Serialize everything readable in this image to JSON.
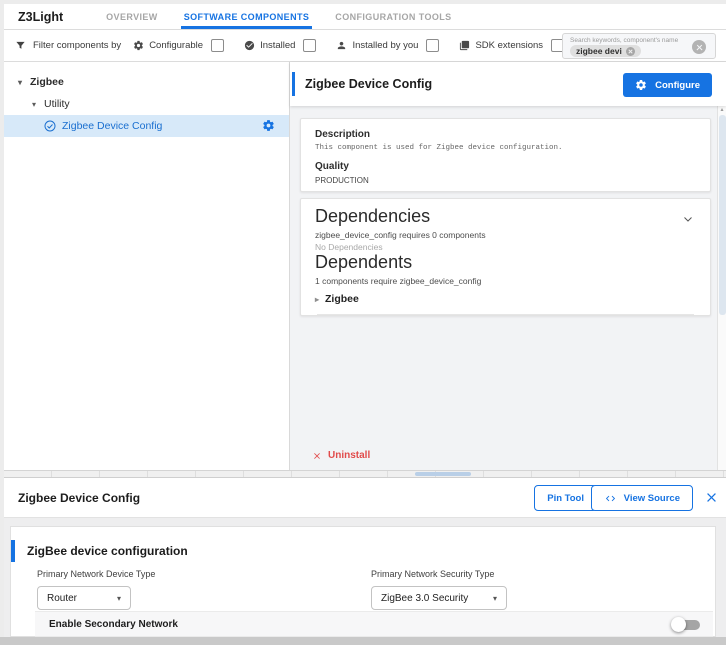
{
  "colors": {
    "accent": "#1673e2",
    "selected_row_bg": "#d7e9f9",
    "uninstall_red": "#e14b4b"
  },
  "header": {
    "project_title": "Z3Light",
    "tabs": [
      {
        "label": "OVERVIEW"
      },
      {
        "label": "SOFTWARE COMPONENTS"
      },
      {
        "label": "CONFIGURATION TOOLS"
      }
    ]
  },
  "filter_bar": {
    "label": "Filter components by",
    "filters": [
      {
        "label": "Configurable",
        "icon": "gear-icon",
        "checked": false
      },
      {
        "label": "Installed",
        "icon": "check-circle-icon",
        "checked": false
      },
      {
        "label": "Installed by you",
        "icon": "person-icon",
        "checked": false
      },
      {
        "label": "SDK extensions",
        "icon": "library-icon",
        "checked": false
      }
    ],
    "search": {
      "placeholder": "Search keywords, component's name",
      "chip_text": "zigbee devi"
    }
  },
  "tree": {
    "root": "Zigbee",
    "group": "Utility",
    "selected_item": "Zigbee Device Config"
  },
  "detail": {
    "title": "Zigbee Device Config",
    "configure_button": "Configure",
    "description_heading": "Description",
    "description_text": "This component is used for Zigbee device configuration.",
    "quality_heading": "Quality",
    "quality_value": "PRODUCTION",
    "dependencies_heading": "Dependencies",
    "dependencies_summary": "zigbee_device_config requires 0 components",
    "dependencies_empty": "No Dependencies",
    "dependents_heading": "Dependents",
    "dependents_summary": "1 components require zigbee_device_config",
    "dependents": [
      {
        "label": "Zigbee"
      }
    ],
    "uninstall_label": "Uninstall"
  },
  "bottom_panel": {
    "title": "Zigbee Device Config",
    "pin_tool_button": "Pin Tool",
    "view_source_button": "View Source",
    "card": {
      "heading": "ZigBee device configuration",
      "fields": [
        {
          "label": "Primary Network Device Type",
          "value": "Router"
        },
        {
          "label": "Primary Network Security Type",
          "value": "ZigBee 3.0 Security"
        }
      ],
      "toggle_label": "Enable Secondary Network",
      "toggle_on": false
    }
  }
}
